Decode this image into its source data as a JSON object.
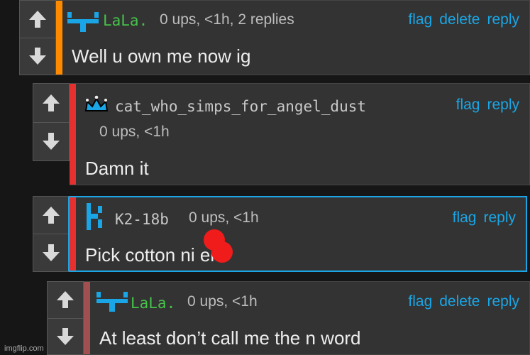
{
  "colors": {
    "link": "#1aa6e6",
    "op_stripe": "#ff8a00",
    "reply_stripe": "#e53030",
    "reply_stripe_muted": "#a05050",
    "lala_name": "#45c24a",
    "user_name": "#c8c8c8"
  },
  "icons": {
    "upvote": "arrow-up-icon",
    "downvote": "arrow-down-icon",
    "lala_badge": "mod-badge-icon",
    "crown_badge": "crown-icon",
    "k2_badge": "k-logo-icon"
  },
  "comments": [
    {
      "username": "LaLa.",
      "meta": "0 ups, <1h, 2 replies",
      "text": "Well u own me now ig",
      "actions": [
        "flag",
        "delete",
        "reply"
      ]
    },
    {
      "username": "cat_who_simps_for_angel_dust",
      "meta": "0 ups, <1h",
      "text": "Damn it",
      "actions": [
        "flag",
        "reply"
      ]
    },
    {
      "username": "K2-18b",
      "meta": "0 ups, <1h",
      "text": "Pick cotton ni  er",
      "actions": [
        "flag",
        "reply"
      ]
    },
    {
      "username": "LaLa.",
      "meta": "0 ups, <1h",
      "text": "At least don’t call me the n word",
      "actions": [
        "flag",
        "delete",
        "reply"
      ]
    }
  ],
  "watermark": "imgflip.com"
}
